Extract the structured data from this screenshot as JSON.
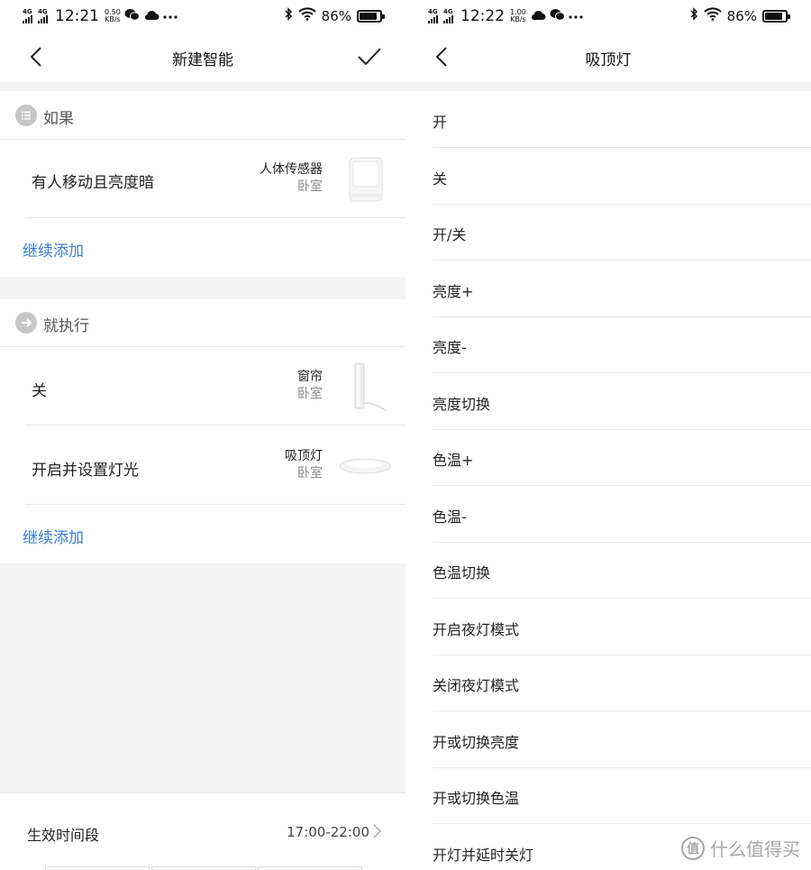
{
  "left": {
    "status": {
      "net1": "4G",
      "net2": "4G",
      "time": "12:21",
      "speed_value": "0.50",
      "speed_unit": "KB/s",
      "battery": "86%",
      "battery_level": 0.86
    },
    "nav": {
      "title": "新建智能"
    },
    "if_section": {
      "label": "如果",
      "condition": {
        "title": "有人移动且亮度暗",
        "device": "人体传感器",
        "room": "卧室"
      },
      "add_label": "继续添加"
    },
    "then_section": {
      "label": "就执行",
      "actions": [
        {
          "title": "关",
          "device": "窗帘",
          "room": "卧室"
        },
        {
          "title": "开启并设置灯光",
          "device": "吸顶灯",
          "room": "卧室"
        }
      ],
      "add_label": "继续添加"
    },
    "footer": {
      "label": "生效时间段",
      "time_range": "17:00-22:00"
    }
  },
  "right": {
    "status": {
      "net1": "4G",
      "net2": "4G",
      "time": "12:22",
      "speed_value": "1.00",
      "speed_unit": "KB/s",
      "battery": "86%",
      "battery_level": 0.86
    },
    "nav": {
      "title": "吸顶灯"
    },
    "items": [
      "开",
      "关",
      "开/关",
      "亮度+",
      "亮度-",
      "亮度切换",
      "色温+",
      "色温-",
      "色温切换",
      "开启夜灯模式",
      "关闭夜灯模式",
      "开或切换亮度",
      "开或切换色温",
      "开灯并延时关灯"
    ]
  },
  "watermark": {
    "badge": "值",
    "text": "什么值得买"
  },
  "icons": {
    "back": "chevron-left-icon",
    "confirm": "checkmark-icon",
    "if": "list-icon",
    "then": "arrow-right-icon",
    "footer": "chevron-right-icon"
  },
  "colors": {
    "link": "#3b7fd0",
    "section_band": "#f4f4f4",
    "section_icon": "#c6c6c6"
  }
}
